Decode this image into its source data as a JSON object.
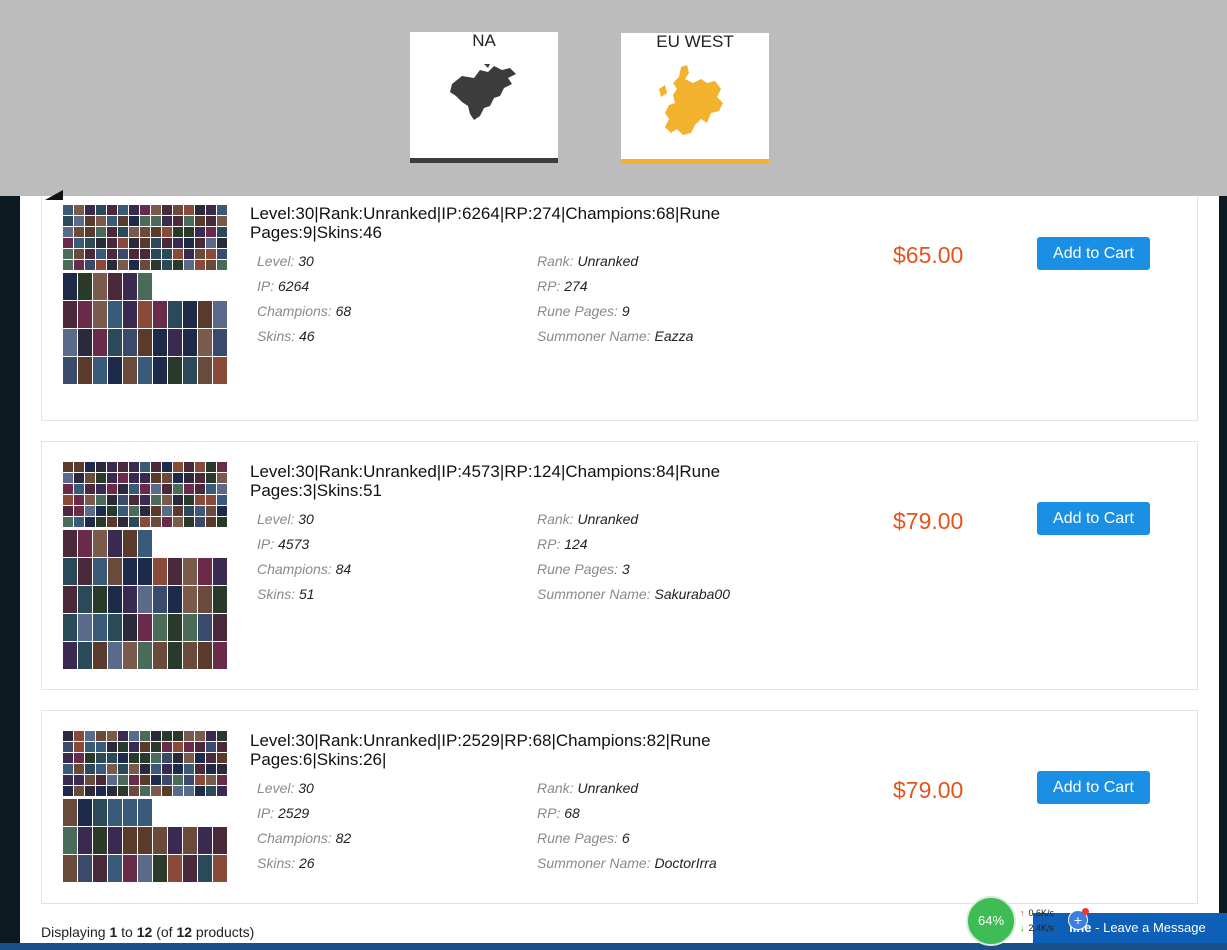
{
  "regions": [
    {
      "label": "NA",
      "icon": "north-america-map-icon",
      "color": "#3c3c3c",
      "active": false
    },
    {
      "label": "EU WEST",
      "icon": "europe-map-icon",
      "color": "#f2b22e",
      "active": true
    }
  ],
  "field_labels": {
    "level": "Level:",
    "rank": "Rank:",
    "ip": "IP:",
    "rp": "RP:",
    "champions": "Champions:",
    "rune_pages": "Rune Pages:",
    "skins": "Skins:",
    "summoner": "Summoner Name:"
  },
  "listings": [
    {
      "title": "Level:30|Rank:Unranked|IP:6264|RP:274|Champions:68|Rune Pages:9|Skins:46",
      "level": "30",
      "rank": "Unranked",
      "ip": "6264",
      "rp": "274",
      "champions": "68",
      "rune_pages": "9",
      "skins": "46",
      "summoner": "Eazza",
      "price": "$65.00",
      "button": "Add to Cart"
    },
    {
      "title": "Level:30|Rank:Unranked|IP:4573|RP:124|Champions:84|Rune Pages:3|Skins:51",
      "level": "30",
      "rank": "Unranked",
      "ip": "4573",
      "rp": "124",
      "champions": "84",
      "rune_pages": "3",
      "skins": "51",
      "summoner": "Sakuraba00",
      "price": "$79.00",
      "button": "Add to Cart"
    },
    {
      "title": "Level:30|Rank:Unranked|IP:2529|RP:68|Champions:82|Rune Pages:6|Skins:26|",
      "level": "30",
      "rank": "Unranked",
      "ip": "2529",
      "rp": "68",
      "champions": "82",
      "rune_pages": "6",
      "skins": "26",
      "summoner": "DoctorIrra",
      "price": "$79.00",
      "button": "Add to Cart"
    }
  ],
  "footer": {
    "prefix": "Displaying ",
    "from": "1",
    "to_word": " to ",
    "to": "12",
    "of_open": " (of ",
    "total": "12",
    "suffix": " products)"
  },
  "speed_widget": {
    "percent": "64%",
    "upload": "0.6K/s",
    "download": "2.4K/s",
    "plus": "+"
  },
  "chat": {
    "bold": "line",
    "rest": " - Leave a Message"
  },
  "colors": {
    "accent_price": "#e4541c",
    "button_blue": "#1a8fe3",
    "top_bar": "#bcbcbc"
  }
}
